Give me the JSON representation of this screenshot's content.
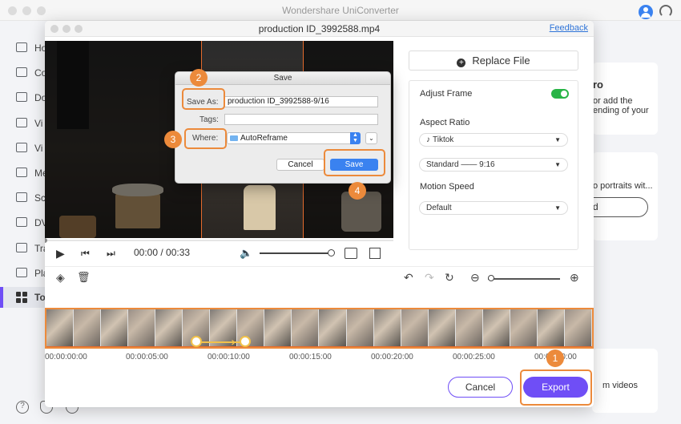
{
  "app": {
    "title": "Wondershare UniConverter"
  },
  "sidebar": {
    "items": [
      {
        "label": "Ho",
        "icon": "home-icon"
      },
      {
        "label": "Co",
        "icon": "converter-icon"
      },
      {
        "label": "Do",
        "icon": "downloader-icon"
      },
      {
        "label": "Vi",
        "icon": "video-compressor-icon"
      },
      {
        "label": "Vi",
        "icon": "video-editor-icon"
      },
      {
        "label": "Me",
        "icon": "merger-icon"
      },
      {
        "label": "Sc",
        "icon": "screen-recorder-icon"
      },
      {
        "label": "DV",
        "icon": "dvd-burner-icon"
      },
      {
        "label": "Tra",
        "icon": "transfer-icon"
      },
      {
        "label": "Pla",
        "icon": "player-icon"
      },
      {
        "label": "To",
        "icon": "toolbox-icon",
        "active": true
      }
    ]
  },
  "background": {
    "card1_text": [
      "ro",
      "or add the",
      "ending of your"
    ],
    "card2_text": "o portraits wit...",
    "card2_button": "d",
    "card3_text": "m videos"
  },
  "editor": {
    "title": "production ID_3992588.mp4",
    "feedback_link": "Feedback",
    "time_display": "00:00 / 00:33",
    "volume_level": 0.97,
    "replace_file_label": "Replace File",
    "adjust_frame_label": "Adjust Frame",
    "adjust_frame_on": true,
    "aspect_ratio_label": "Aspect Ratio",
    "platform_value": "Tiktok",
    "ratio_value": "Standard —— 9:16",
    "motion_speed_label": "Motion Speed",
    "motion_speed_value": "Default",
    "ruler_ticks": [
      "00:00:00:00",
      "00:00:05:00",
      "00:00:10:00",
      "00:00:15:00",
      "00:00:20:00",
      "00:00:25:00",
      "00:00:30:00"
    ],
    "cancel_label": "Cancel",
    "export_label": "Export"
  },
  "save_dialog": {
    "title": "Save",
    "save_as_label": "Save As:",
    "save_as_value": "production ID_3992588-9/16",
    "tags_label": "Tags:",
    "tags_value": "",
    "where_label": "Where:",
    "where_value": "AutoReframe",
    "cancel_label": "Cancel",
    "save_label": "Save"
  },
  "callouts": {
    "step1": "1",
    "step2": "2",
    "step3": "3",
    "step4": "4",
    "color": "#ec8a3b"
  },
  "colors": {
    "accent": "#6f4ef6",
    "crop_frame": "#e56b2d",
    "toggle_on": "#28b446",
    "mac_blue": "#3a82f0"
  }
}
